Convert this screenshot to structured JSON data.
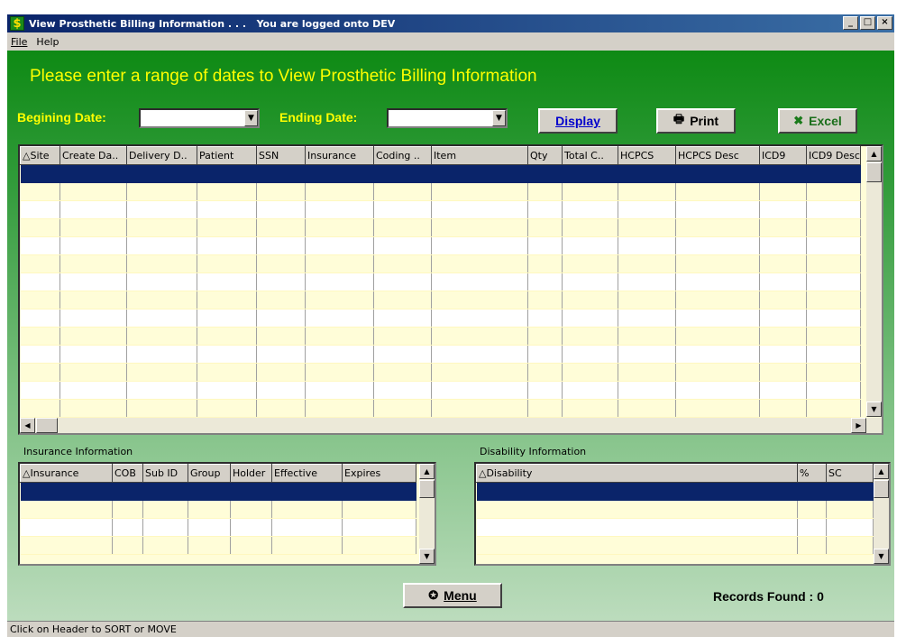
{
  "window": {
    "title": "View Prosthetic Billing Information . . .   You are logged onto DEV",
    "icon": "dollar-icon"
  },
  "menu": {
    "file": "File",
    "help": "Help"
  },
  "heading": "Please enter a range of dates to View Prosthetic Billing Information",
  "dates": {
    "begin_label": "Begining Date:",
    "begin_value": "",
    "end_label": "Ending Date:",
    "end_value": ""
  },
  "buttons": {
    "display": "Display",
    "print": "Print",
    "excel": "Excel",
    "menu": "Menu"
  },
  "main_grid": {
    "columns": [
      "Site",
      "Create Da..",
      "Delivery D..",
      "Patient",
      "SSN",
      "Insurance",
      "Coding ..",
      "Item",
      "Qty",
      "Total C..",
      "HCPCS",
      "HCPCS Desc",
      "ICD9",
      "ICD9 Desc"
    ],
    "rows": 14
  },
  "insurance": {
    "label": "Insurance Information",
    "columns": [
      "Insurance",
      "COB",
      "Sub ID",
      "Group",
      "Holder",
      "Effective",
      "Expires"
    ],
    "rows": 4
  },
  "disability": {
    "label": "Disability Information",
    "columns": [
      "Disability",
      "%",
      "SC"
    ],
    "rows": 4
  },
  "records_found": "Records Found : 0",
  "status": "Click on Header to SORT or MOVE",
  "colors": {
    "selection": "#0a246a",
    "row_alt": "#fffdd8",
    "heading": "#ffff00",
    "green": "#0e8a14"
  }
}
